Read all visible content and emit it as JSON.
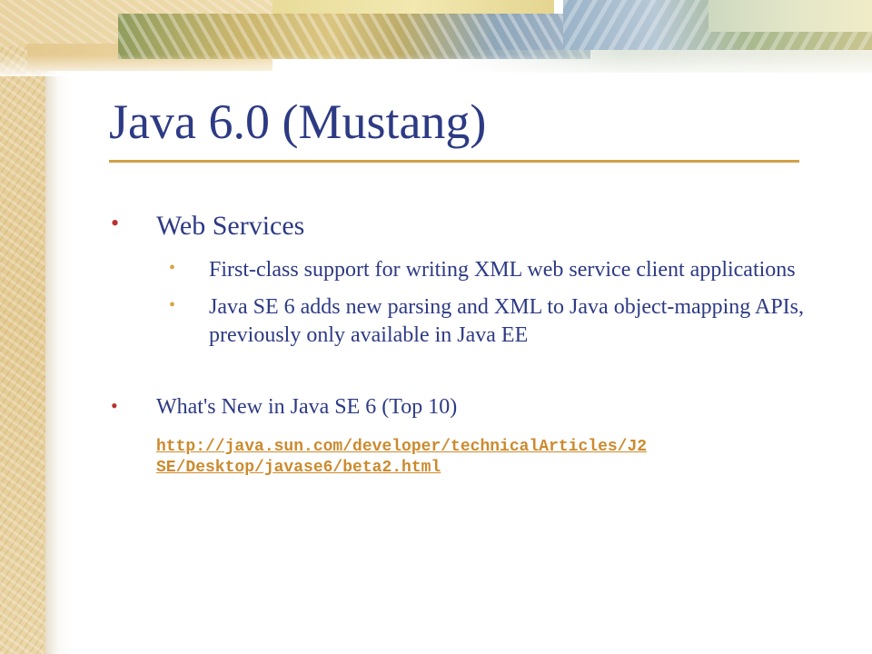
{
  "slide": {
    "title": "Java 6.0  (Mustang)",
    "bullets": [
      {
        "text": "Web Services",
        "sub": [
          "First-class support for writing XML web service client applications",
          "Java SE 6 adds new parsing and XML to Java object-mapping APIs, previously only available in Java EE"
        ]
      },
      {
        "text": "What's New in Java SE 6 (Top 10)",
        "link": "http://java.sun.com/developer/technicalArticles/J2SE/Desktop/javase6/beta2.html"
      }
    ]
  },
  "colors": {
    "title": "#2d3a84",
    "rule": "#d3a046",
    "bullet_l1": "#b9332f",
    "bullet_l2": "#d7a347",
    "link": "#cc8a2e"
  }
}
